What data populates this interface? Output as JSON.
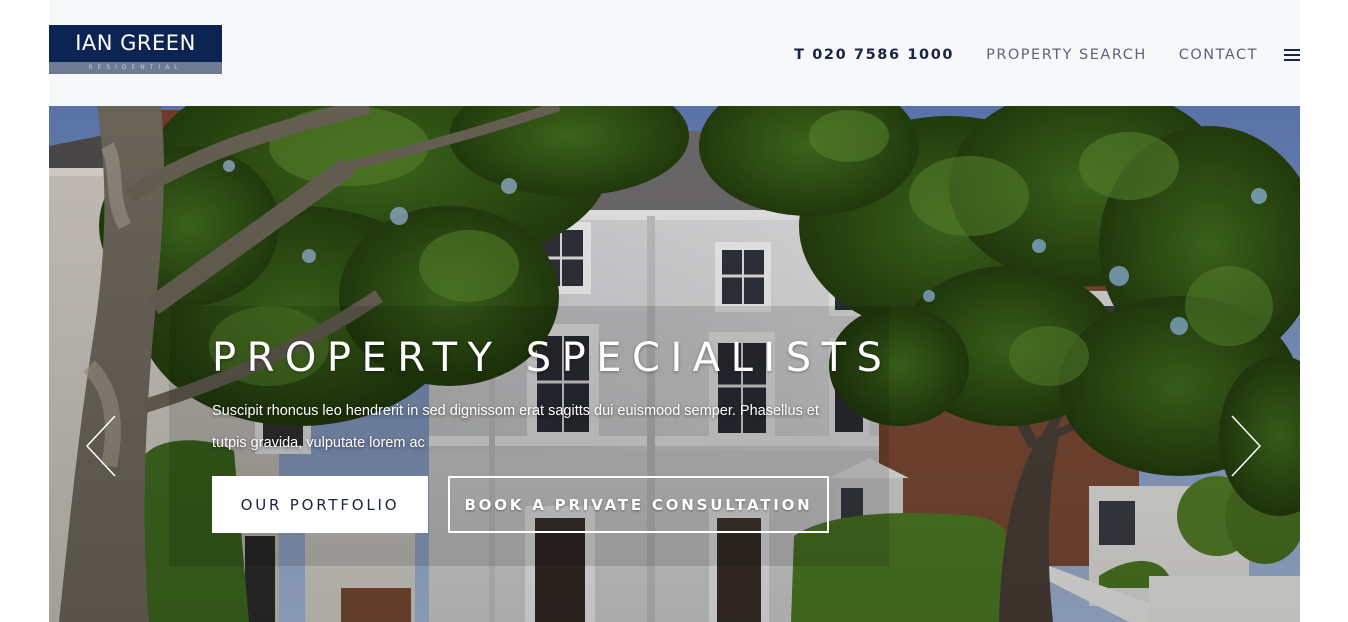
{
  "header": {
    "logo": {
      "name": "IAN GREEN",
      "tagline": "RESIDENTIAL"
    },
    "phone": "T 020 7586 1000",
    "nav": {
      "property_search": "PROPERTY SEARCH",
      "contact": "CONTACT"
    },
    "menu_icon": "hamburger-menu-icon"
  },
  "hero": {
    "headline": "PROPERTY SPECIALISTS",
    "subtext": "Suscipit rhoncus leo hendrerit in sed dignissom erat sagitts dui euismood semper. Phasellus et tutpis gravida, vulputate lorem ac",
    "buttons": {
      "portfolio": "OUR PORTFOLIO",
      "consultation": "BOOK A PRIVATE CONSULTATION"
    },
    "prev_icon": "chevron-left-icon",
    "next_icon": "chevron-right-icon"
  },
  "colors": {
    "brand_navy": "#0c2454",
    "header_bg": "#f7f8fa",
    "nav_text": "#5c6577",
    "phone_text": "#1b2440"
  }
}
